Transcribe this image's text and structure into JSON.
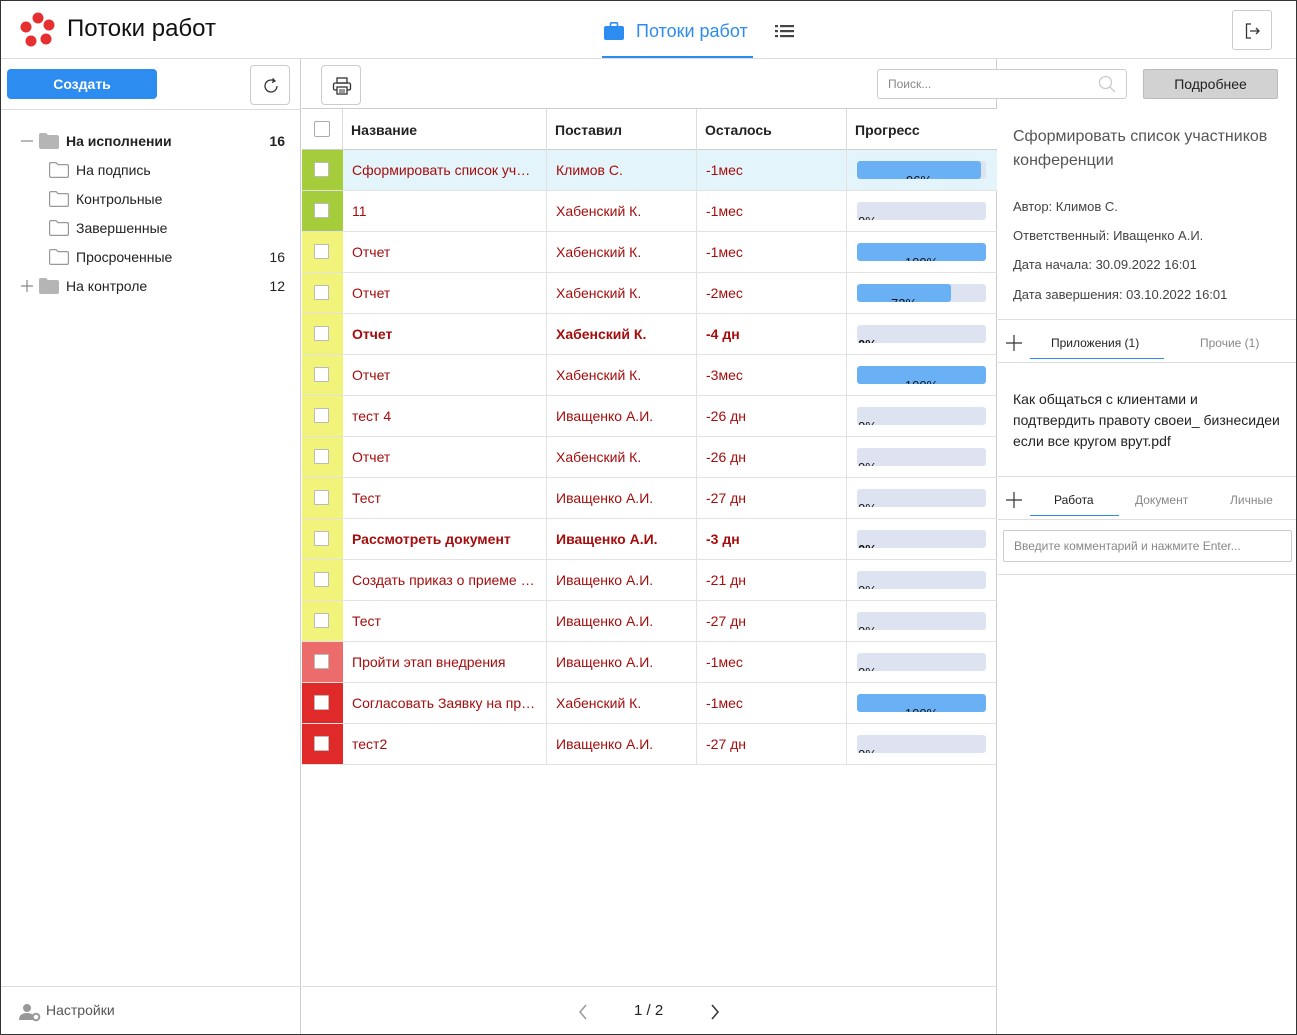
{
  "header": {
    "app_title": "Потоки работ",
    "nav_tab_label": "Потоки работ",
    "colors": {
      "accent": "#2d8cf0",
      "logo": "#e63030"
    }
  },
  "left": {
    "create_label": "Создать",
    "tree": [
      {
        "label": "На исполнении",
        "count": "16",
        "expander": "minus",
        "bold": true,
        "level": 0
      },
      {
        "label": "На подпись",
        "count": "",
        "level": 1
      },
      {
        "label": "Контрольные",
        "count": "",
        "level": 1
      },
      {
        "label": "Завершенные",
        "count": "",
        "level": 1
      },
      {
        "label": "Просроченные",
        "count": "16",
        "level": 1
      },
      {
        "label": "На контроле",
        "count": "12",
        "expander": "plus",
        "level": 0
      }
    ],
    "settings_label": "Настройки"
  },
  "toolbar": {
    "search_placeholder": "Поиск...",
    "more_label": "Подробнее"
  },
  "table": {
    "columns": [
      "Название",
      "Поставил",
      "Осталось",
      "Прогресс"
    ],
    "rows": [
      {
        "name": "Сформировать список участников конференции",
        "by": "Климов С.",
        "left": "-1мес",
        "progress": 96,
        "progress_label": "96%",
        "color": "#a5cc3a",
        "selected": true,
        "bold": false
      },
      {
        "name": "11",
        "by": "Хабенский К.",
        "left": "-1мес",
        "progress": 0,
        "progress_label": "0%",
        "color": "#a5cc3a",
        "bold": false
      },
      {
        "name": "Отчет",
        "by": "Хабенский К.",
        "left": "-1мес",
        "progress": 100,
        "progress_label": "100%",
        "color": "#f1f37a",
        "bold": false
      },
      {
        "name": "Отчет",
        "by": "Хабенский К.",
        "left": "-2мес",
        "progress": 73,
        "progress_label": "73%",
        "color": "#f1f37a",
        "bold": false
      },
      {
        "name": "Отчет",
        "by": "Хабенский К.",
        "left": "-4 дн",
        "progress": 0,
        "progress_label": "0%",
        "color": "#f1f37a",
        "bold": true
      },
      {
        "name": "Отчет",
        "by": "Хабенский К.",
        "left": "-3мес",
        "progress": 100,
        "progress_label": "100%",
        "color": "#f1f37a",
        "bold": false
      },
      {
        "name": "тест 4",
        "by": "Иващенко А.И.",
        "left": "-26 дн",
        "progress": 0,
        "progress_label": "0%",
        "color": "#f1f37a",
        "bold": false
      },
      {
        "name": "Отчет",
        "by": "Хабенский К.",
        "left": "-26 дн",
        "progress": 0,
        "progress_label": "0%",
        "color": "#f1f37a",
        "bold": false
      },
      {
        "name": "Тест",
        "by": "Иващенко А.И.",
        "left": "-27 дн",
        "progress": 0,
        "progress_label": "0%",
        "color": "#f1f37a",
        "bold": false
      },
      {
        "name": "Рассмотреть документ",
        "by": "Иващенко А.И.",
        "left": "-3 дн",
        "progress": 0,
        "progress_label": "0%",
        "color": "#f1f37a",
        "bold": true
      },
      {
        "name": "Создать приказ о приеме на работу",
        "by": "Иващенко А.И.",
        "left": "-21 дн",
        "progress": 0,
        "progress_label": "0%",
        "color": "#f1f37a",
        "bold": false
      },
      {
        "name": "Тест",
        "by": "Иващенко А.И.",
        "left": "-27 дн",
        "progress": 0,
        "progress_label": "0%",
        "color": "#f1f37a",
        "bold": false
      },
      {
        "name": "Пройти этап внедрения",
        "by": "Иващенко А.И.",
        "left": "-1мес",
        "progress": 0,
        "progress_label": "0%",
        "color": "#ec6b6b",
        "bold": false
      },
      {
        "name": "Согласовать Заявку на приобретение",
        "by": "Хабенский К.",
        "left": "-1мес",
        "progress": 100,
        "progress_label": "100%",
        "color": "#e02a2a",
        "bold": false
      },
      {
        "name": "тест2",
        "by": "Иващенко А.И.",
        "left": "-27 дн",
        "progress": 0,
        "progress_label": "0%",
        "color": "#e02a2a",
        "bold": false
      }
    ]
  },
  "pager": {
    "label": "1 / 2"
  },
  "detail": {
    "title": "Сформировать список участников конференции",
    "author": "Автор: Климов С.",
    "responsible": "Ответственный: Иващенко А.И.",
    "start": "Дата начала: 30.09.2022 16:01",
    "end": "Дата завершения: 03.10.2022 16:01",
    "tabs1": [
      "Приложения (1)",
      "Прочие (1)"
    ],
    "attachment": "Как общаться с клиентами и подтвердить правоту своеи_ бизнесидеи если все кругом врут.pdf",
    "tabs2": [
      "Работа",
      "Документ",
      "Личные"
    ],
    "comment_placeholder": "Введите комментарий и нажмите Enter..."
  }
}
